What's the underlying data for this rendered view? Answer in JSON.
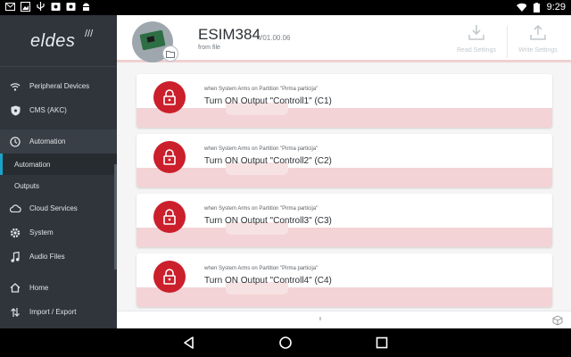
{
  "status_bar": {
    "time": "9:29",
    "left_icons": [
      "mail-icon",
      "image-icon",
      "usb-icon",
      "media-icon",
      "media-icon",
      "android-icon"
    ],
    "right_icons": [
      "wifi-icon",
      "battery-icon"
    ]
  },
  "sidebar": {
    "brand": "eldes",
    "items": [
      {
        "label": "Peripheral Devices",
        "icon": "wifi-icon"
      },
      {
        "label": "CMS (AKC)",
        "icon": "shield-icon"
      },
      {
        "label": "Automation",
        "icon": "clock-icon"
      },
      {
        "label": "Automation",
        "icon": ""
      },
      {
        "label": "Outputs",
        "icon": ""
      },
      {
        "label": "Cloud Services",
        "icon": "cloud-icon"
      },
      {
        "label": "System",
        "icon": "gear-icon"
      },
      {
        "label": "Audio Files",
        "icon": "music-icon"
      },
      {
        "label": "Home",
        "icon": "home-icon"
      },
      {
        "label": "Import / Export",
        "icon": "import-export-icon"
      }
    ]
  },
  "header": {
    "device_name": "ESIM384",
    "version": "V01.00.06",
    "source": "from file",
    "read_label": "Read Settings",
    "write_label": "Write Settings"
  },
  "rules": [
    {
      "condition": "when System Arms on Partition \"Pirma particija\"",
      "action": "Turn ON Output \"Controll1\" (C1)"
    },
    {
      "condition": "when System Arms on Partition \"Pirma particija\"",
      "action": "Turn ON Output \"Controll2\" (C2)"
    },
    {
      "condition": "when System Arms on Partition \"Pirma particija\"",
      "action": "Turn ON Output \"Controll3\" (C3)"
    },
    {
      "condition": "when System Arms on Partition \"Pirma particija\"",
      "action": "Turn ON Output \"Controll4\" (C4)"
    }
  ],
  "footer": {
    "page_indicator": "ı"
  },
  "colors": {
    "accent": "#cb1f2c",
    "selected_bar": "#1aa3c8",
    "sidebar_bg": "#2f353b"
  }
}
